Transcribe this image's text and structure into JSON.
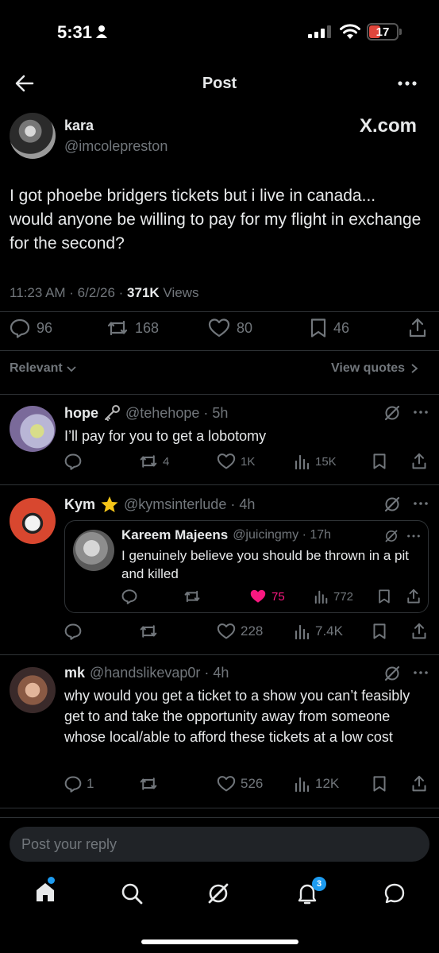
{
  "status_bar": {
    "time": "5:31",
    "battery": "17"
  },
  "header": {
    "title": "Post"
  },
  "post": {
    "author_name": "kara",
    "author_handle": "@imcolepreston",
    "source": "X.com",
    "text": "I got phoebe bridgers tickets but i live in canada... would anyone be willing to pay for my flight in exchange for the second?",
    "time": "11:23 AM · 6/2/26 · ",
    "views": "371K",
    "views_label": " Views",
    "replies": "96",
    "reposts": "168",
    "likes": "80",
    "bookmarks": "46"
  },
  "sort": {
    "label": "Relevant",
    "view_quotes": "View quotes"
  },
  "replies": [
    {
      "name": "hope",
      "handle": "@tehehope · 5h",
      "text": "I’ll pay for you to get a lobotomy",
      "reposts": "4",
      "likes": "1K",
      "views": "15K"
    },
    {
      "name": "Kym",
      "handle": "@kymsinterlude · 4h",
      "likes": "228",
      "views": "7.4K",
      "quote": {
        "name": "Kareem Majeens",
        "handle": "@juicingmy · 17h",
        "text": "I genuinely believe you should be thrown in a pit and killed",
        "likes": "75",
        "views": "772"
      }
    },
    {
      "name": "mk",
      "handle": "@handslikevap0r · 4h",
      "text": "why would you get a ticket to a show you can’t feasibly get to and take the opportunity away from someone whose local/able to afford these tickets at a low cost",
      "replies": "1",
      "likes": "526",
      "views": "12K"
    }
  ],
  "composer": {
    "placeholder": "Post your reply"
  },
  "tab_bar": {
    "notifications_badge": "3"
  },
  "colors": {
    "accent": "#1d9bf0",
    "like_active": "#f91880",
    "battery_low": "#e0463c"
  }
}
